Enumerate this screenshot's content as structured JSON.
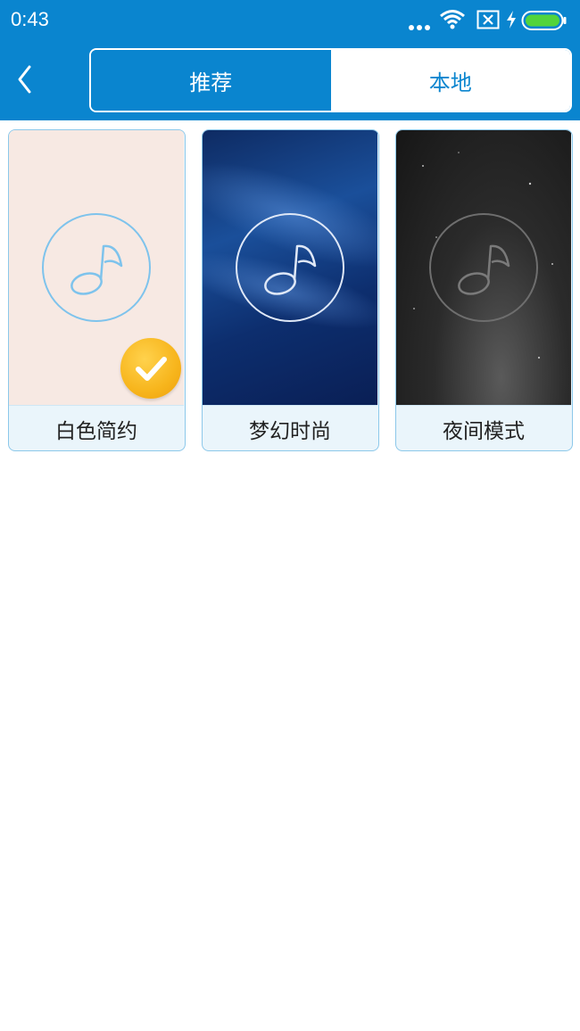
{
  "status_bar": {
    "time": "0:43",
    "icons": [
      "more-dots-icon",
      "wifi-icon",
      "sim-x-icon",
      "charging-bolt-icon",
      "battery-icon"
    ]
  },
  "app_bar": {
    "back_icon": "chevron-left-icon",
    "tabs": [
      {
        "label": "推荐",
        "active": true
      },
      {
        "label": "本地",
        "active": false
      }
    ]
  },
  "themes": [
    {
      "label": "白色简约",
      "selected": true
    },
    {
      "label": "梦幻时尚",
      "selected": false
    },
    {
      "label": "夜间模式",
      "selected": false
    }
  ],
  "colors": {
    "primary": "#0a85cf",
    "card_border": "#8cc8ea",
    "check_badge": "#f7b51c"
  }
}
